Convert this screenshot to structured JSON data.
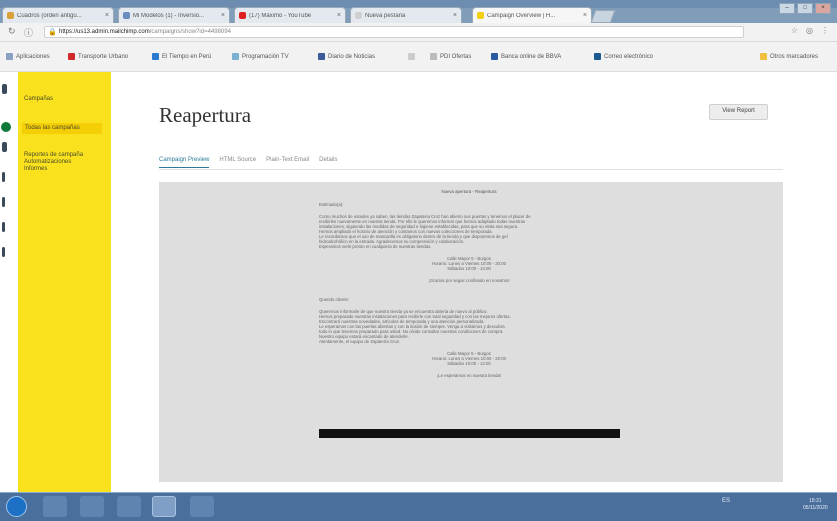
{
  "browser": {
    "tabs": [
      {
        "label": "Cuadros (orden antigu...",
        "fav": "#d8a13a"
      },
      {
        "label": "Mi Modelos (1) - Inversio...",
        "fav": "#6b8cc0"
      },
      {
        "label": "(17) Máximo - YouTube",
        "fav": "#e02020"
      },
      {
        "label": "Nueva pestaña",
        "fav": "#d0d0d0"
      },
      {
        "label": "Campaign Overview | H...",
        "fav": "#f3cf0c"
      }
    ],
    "url_host": "https://us13.admin.mailchimp.com",
    "url_path": "/campaigns/show?id=4498094",
    "bookmarks": [
      {
        "label": "Aplicaciones",
        "color": "#8aa0c2"
      },
      {
        "label": "Transporte Urbano",
        "color": "#d02a2a"
      },
      {
        "label": "El Tiempo en Perú",
        "color": "#2a7ad0"
      },
      {
        "label": "Programación TV",
        "color": "#7ab0d0"
      },
      {
        "label": "Diario de Noticias",
        "color": "#3b5a9a"
      },
      {
        "label": "",
        "color": "#cccccc"
      },
      {
        "label": "PDI Ofertas",
        "color": "#bbbbbb"
      },
      {
        "label": "Banca online de BBVA",
        "color": "#2a5aa0"
      },
      {
        "label": "Correo electrónico",
        "color": "#1a5a90"
      },
      {
        "label": "Otros marcadores",
        "color": "#f0c040"
      }
    ]
  },
  "sidebar": {
    "items": [
      "Campañas",
      "Todas las campañas",
      "Reportes de campaña",
      "Automatizaciones",
      "Informes"
    ]
  },
  "page": {
    "title": "Reapertura",
    "report_button": "View Report",
    "tabs": [
      "Campaign Preview",
      "HTML Source",
      "Plain-Text Email",
      "Details"
    ]
  },
  "email": {
    "heading": "Nueva apertura - Reapertura",
    "section1_title": "Estimado(a):",
    "section1_paragraphs": [
      "Como muchos de ustedes ya saben, las tiendas Zapateria Cruz han abierto sus puertas y tenemos el placer de",
      "recibirles nuevamente en nuestra tienda. Por ello le queremos informar que hemos adaptado todas nuestras",
      "instalaciones, siguiendo las medidas de seguridad e higiene establecidas, para que su visita sea segura.",
      "Hemos ampliado el horario de atención y contamos con nuevas colecciones de temporada.",
      "Le recordamos que el uso de mascarilla es obligatorio dentro de la tienda y que disponemos de gel",
      "hidroalcohólico en la entrada. Agradecemos su comprensión y colaboración.",
      "Esperamos verle pronto en cualquiera de nuestras tiendas."
    ],
    "section1_center": [
      "Calle Mayor 5 - Burgos",
      "Horario: Lunes a Viernes 10:00 - 20:00",
      "Sábados 10:00 - 14:00"
    ],
    "section1_note": "¡Gracias por seguir confiando en nosotros!",
    "section2_title": "Querido cliente:",
    "section2_paragraphs": [
      "Queremos informarle de que nuestra tienda ya se encuentra abierta de nuevo al público.",
      "Hemos preparado nuestras instalaciones para recibirle con total seguridad y con las mejores ofertas.",
      "Encontrará nuestras novedades, artículos de temporada y una atención personalizada.",
      "Le esperamos con las puertas abiertas y con la ilusión de siempre. Venga a visitarnos y descubra",
      "todo lo que tenemos preparado para usted. No olvide consultar nuestras condiciones de compra.",
      "Nuestro equipo estará encantado de atenderle.",
      "Atentamente, el equipo de Zapatería Cruz."
    ],
    "section2_center": [
      "Calle Mayor 5 - Burgos",
      "Horario: Lunes a Viernes 10:00 - 20:00",
      "Sábados 10:00 - 14:00"
    ],
    "section2_note": "¡Le esperamos en nuestra tienda!"
  },
  "taskbar": {
    "tray_text": "ES",
    "clock_time": "18:31",
    "clock_date": "05/11/2020"
  }
}
